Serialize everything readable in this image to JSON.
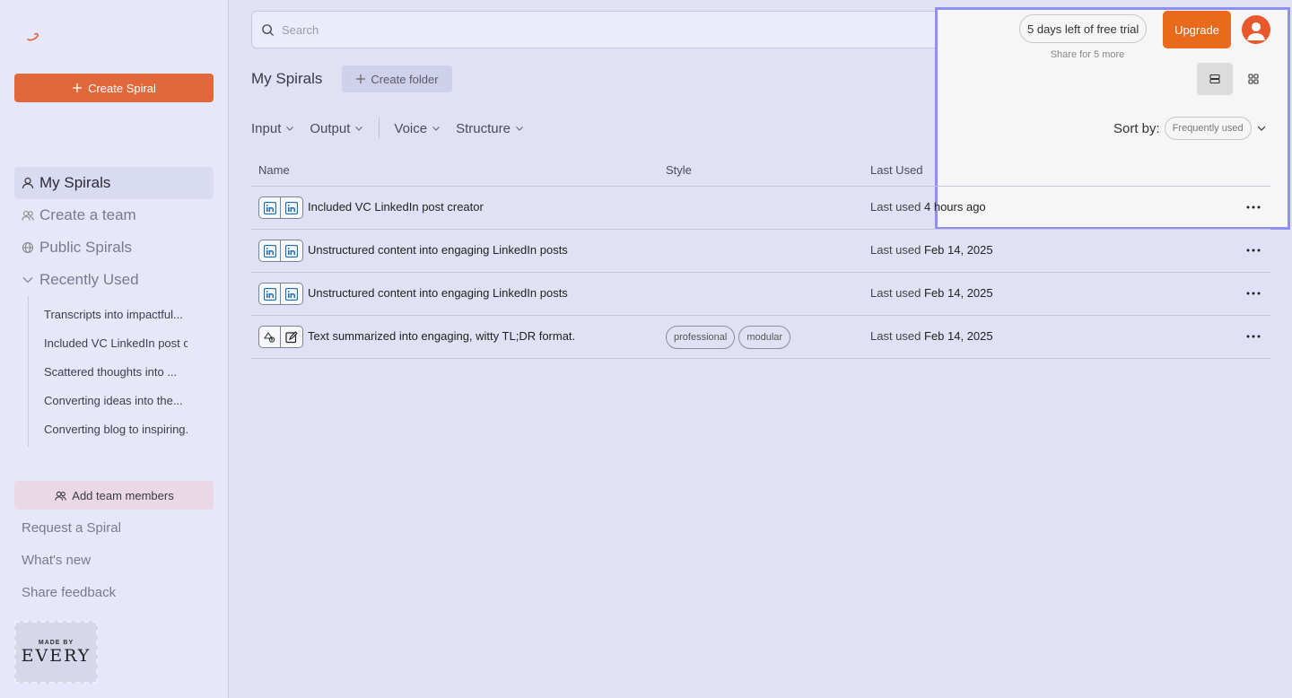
{
  "sidebar": {
    "create_label": "Create Spiral",
    "nav": [
      {
        "label": "My Spirals"
      },
      {
        "label": "Create a team"
      },
      {
        "label": "Public Spirals"
      },
      {
        "label": "Recently Used"
      }
    ],
    "recent": [
      "Transcripts into impactful...",
      "Included VC LinkedIn post creator",
      "Scattered thoughts into ...",
      "Converting ideas into the...",
      "Converting blog to inspiring..."
    ],
    "add_team_label": "Add team members",
    "footer": [
      "Request a Spiral",
      "What's new",
      "Share feedback"
    ],
    "stamp": {
      "small": "MADE BY",
      "big": "EVERY"
    }
  },
  "search": {
    "placeholder": "Search"
  },
  "trial": {
    "text": "5 days left of free trial",
    "share": "Share for 5 more",
    "upgrade_label": "Upgrade"
  },
  "page": {
    "title": "My Spirals",
    "create_folder_label": "Create folder"
  },
  "filters": [
    "Input",
    "Output",
    "Voice",
    "Structure"
  ],
  "sort": {
    "label": "Sort by:",
    "value": "Frequently used"
  },
  "table": {
    "headers": {
      "name": "Name",
      "style": "Style",
      "last_used": "Last Used"
    },
    "rows": [
      {
        "name": "Included VC LinkedIn post creator",
        "used_prefix": "Last used",
        "used_value": "4 hours ago",
        "tags": [],
        "icons": [
          "linkedin-icon",
          "linkedin-icon"
        ]
      },
      {
        "name": "Unstructured content into engaging LinkedIn posts",
        "used_prefix": "Last used",
        "used_value": "Feb 14, 2025",
        "tags": [],
        "icons": [
          "linkedin-icon",
          "linkedin-icon"
        ]
      },
      {
        "name": "Unstructured content into engaging LinkedIn posts",
        "used_prefix": "Last used",
        "used_value": "Feb 14, 2025",
        "tags": [],
        "icons": [
          "linkedin-icon",
          "linkedin-icon"
        ]
      },
      {
        "name": "Text summarized into engaging, witty TL;DR format.",
        "used_prefix": "Last used",
        "used_value": "Feb 14, 2025",
        "tags": [
          "professional",
          "modular"
        ],
        "icons": [
          "shapes-icon",
          "edit-icon"
        ]
      }
    ]
  },
  "colors": {
    "accent": "#e0683a",
    "upgrade": "#ea6a1c",
    "linkedin": "#1f6fb5"
  }
}
